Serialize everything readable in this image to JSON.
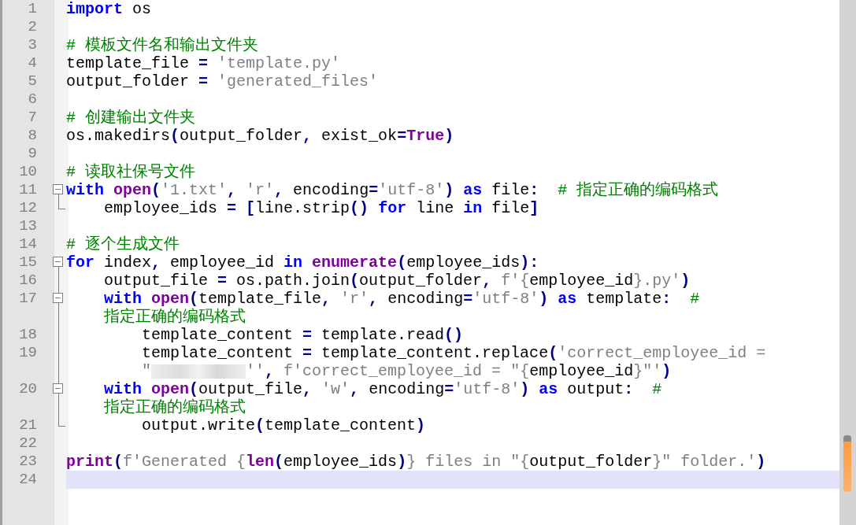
{
  "editor": {
    "lines": [
      {
        "number": "1",
        "current": false,
        "kind": "plain",
        "rows": [
          {
            "tokens": [
              {
                "kind": "keyword",
                "text": "import"
              },
              {
                "kind": "text",
                "text": " os"
              }
            ]
          }
        ]
      },
      {
        "number": "2",
        "current": false,
        "kind": "plain"
      },
      {
        "number": "3",
        "current": false,
        "kind": "plain",
        "rows": [
          {
            "tokens": [
              {
                "kind": "comment",
                "text": "# 模板文件名和输出文件夹"
              }
            ]
          }
        ]
      },
      {
        "number": "4",
        "current": false,
        "kind": "plain",
        "rows": [
          {
            "tokens": [
              {
                "kind": "text",
                "text": "template_file "
              },
              {
                "kind": "operator",
                "text": "="
              },
              {
                "kind": "string",
                "text": " 'template.py'"
              }
            ]
          }
        ]
      },
      {
        "number": "5",
        "current": false,
        "kind": "plain",
        "rows": [
          {
            "tokens": [
              {
                "kind": "text",
                "text": "output_folder "
              },
              {
                "kind": "operator",
                "text": "="
              },
              {
                "kind": "string",
                "text": " 'generated_files'"
              }
            ]
          }
        ]
      },
      {
        "number": "6",
        "current": false,
        "kind": "plain"
      },
      {
        "number": "7",
        "current": false,
        "kind": "plain",
        "rows": [
          {
            "tokens": [
              {
                "kind": "comment",
                "text": "# 创建输出文件夹"
              }
            ]
          }
        ]
      },
      {
        "number": "8",
        "current": false,
        "kind": "plain",
        "rows": [
          {
            "tokens": [
              {
                "kind": "text",
                "text": "os.makedirs"
              },
              {
                "kind": "operator",
                "text": "("
              },
              {
                "kind": "text",
                "text": "output_folder"
              },
              {
                "kind": "operator",
                "text": ","
              },
              {
                "kind": "text",
                "text": " exist_ok"
              },
              {
                "kind": "operator",
                "text": "="
              },
              {
                "kind": "builtin",
                "text": "True"
              },
              {
                "kind": "operator",
                "text": ")"
              }
            ]
          }
        ]
      },
      {
        "number": "9",
        "current": false,
        "kind": "plain"
      },
      {
        "number": "10",
        "current": false,
        "kind": "plain",
        "rows": [
          {
            "tokens": [
              {
                "kind": "comment",
                "text": "# 读取社保号文件"
              }
            ]
          }
        ]
      },
      {
        "number": "11",
        "current": false,
        "kind": "opener",
        "rows": [
          {
            "tokens": [
              {
                "kind": "keyword",
                "text": "with"
              },
              {
                "kind": "builtin",
                "text": " open"
              },
              {
                "kind": "operator",
                "text": "("
              },
              {
                "kind": "string",
                "text": "'1.txt'"
              },
              {
                "kind": "operator",
                "text": ","
              },
              {
                "kind": "string",
                "text": " 'r'"
              },
              {
                "kind": "operator",
                "text": ","
              },
              {
                "kind": "text",
                "text": " encoding"
              },
              {
                "kind": "operator",
                "text": "="
              },
              {
                "kind": "string",
                "text": "'utf-8'"
              },
              {
                "kind": "operator",
                "text": ")"
              },
              {
                "kind": "keyword",
                "text": " as"
              },
              {
                "kind": "text",
                "text": " file"
              },
              {
                "kind": "operator",
                "text": ":"
              },
              {
                "kind": "comment",
                "text": "  # 指定正确的编码格式"
              }
            ]
          }
        ]
      },
      {
        "number": "12",
        "current": false,
        "kind": "closer",
        "rows": [
          {
            "tokens": [
              {
                "kind": "text",
                "text": "    employee_ids "
              },
              {
                "kind": "operator",
                "text": "="
              },
              {
                "kind": "operator",
                "text": " ["
              },
              {
                "kind": "text",
                "text": "line.strip"
              },
              {
                "kind": "operator",
                "text": "()"
              },
              {
                "kind": "keyword",
                "text": " for"
              },
              {
                "kind": "text",
                "text": " line "
              },
              {
                "kind": "keyword",
                "text": "in"
              },
              {
                "kind": "text",
                "text": " file"
              },
              {
                "kind": "operator",
                "text": "]"
              }
            ]
          }
        ]
      },
      {
        "number": "13",
        "current": false,
        "kind": "plain"
      },
      {
        "number": "14",
        "current": false,
        "kind": "plain",
        "rows": [
          {
            "tokens": [
              {
                "kind": "comment",
                "text": "# 逐个生成文件"
              }
            ]
          }
        ]
      },
      {
        "number": "15",
        "current": false,
        "kind": "opener",
        "rows": [
          {
            "tokens": [
              {
                "kind": "keyword",
                "text": "for"
              },
              {
                "kind": "text",
                "text": " index"
              },
              {
                "kind": "operator",
                "text": ","
              },
              {
                "kind": "text",
                "text": " employee_id "
              },
              {
                "kind": "keyword",
                "text": "in"
              },
              {
                "kind": "builtin",
                "text": " enumerate"
              },
              {
                "kind": "operator",
                "text": "("
              },
              {
                "kind": "text",
                "text": "employee_ids"
              },
              {
                "kind": "operator",
                "text": "):"
              }
            ]
          }
        ]
      },
      {
        "number": "16",
        "current": false,
        "kind": "inner",
        "rows": [
          {
            "tokens": [
              {
                "kind": "text",
                "text": "    output_file "
              },
              {
                "kind": "operator",
                "text": "="
              },
              {
                "kind": "text",
                "text": " os.path.join"
              },
              {
                "kind": "operator",
                "text": "("
              },
              {
                "kind": "text",
                "text": "output_folder"
              },
              {
                "kind": "operator",
                "text": ","
              },
              {
                "kind": "string",
                "text": " f'{"
              },
              {
                "kind": "text",
                "text": "employee_id"
              },
              {
                "kind": "string",
                "text": "}.py'"
              },
              {
                "kind": "operator",
                "text": ")"
              }
            ]
          }
        ]
      },
      {
        "number": "17",
        "current": false,
        "kind": "opener",
        "rows": [
          {
            "tokens": [
              {
                "kind": "keyword",
                "text": "    with"
              },
              {
                "kind": "builtin",
                "text": " open"
              },
              {
                "kind": "operator",
                "text": "("
              },
              {
                "kind": "text",
                "text": "template_file"
              },
              {
                "kind": "operator",
                "text": ","
              },
              {
                "kind": "string",
                "text": " 'r'"
              },
              {
                "kind": "operator",
                "text": ","
              },
              {
                "kind": "text",
                "text": " encoding"
              },
              {
                "kind": "operator",
                "text": "="
              },
              {
                "kind": "string",
                "text": "'utf-8'"
              },
              {
                "kind": "operator",
                "text": ")"
              },
              {
                "kind": "keyword",
                "text": " as"
              },
              {
                "kind": "text",
                "text": " template"
              },
              {
                "kind": "operator",
                "text": ":"
              },
              {
                "kind": "comment",
                "text": "  #"
              }
            ]
          },
          {
            "tokens": [
              {
                "kind": "comment",
                "text": "指定正确的编码格式"
              }
            ]
          }
        ]
      },
      {
        "number": "18",
        "current": false,
        "kind": "inner",
        "rows": [
          {
            "tokens": [
              {
                "kind": "text",
                "text": "        template_content "
              },
              {
                "kind": "operator",
                "text": "="
              },
              {
                "kind": "text",
                "text": " template.read"
              },
              {
                "kind": "operator",
                "text": "()"
              }
            ]
          }
        ]
      },
      {
        "number": "19",
        "current": false,
        "kind": "inner",
        "rows": [
          {
            "tokens": [
              {
                "kind": "text",
                "text": "        template_content "
              },
              {
                "kind": "operator",
                "text": "="
              },
              {
                "kind": "text",
                "text": " template_content.replace"
              },
              {
                "kind": "operator",
                "text": "("
              },
              {
                "kind": "string",
                "text": "'correct_employee_id ="
              }
            ]
          },
          {
            "tokens": [
              {
                "kind": "string",
                "text": "\""
              },
              {
                "kind": "redacted"
              },
              {
                "kind": "string",
                "text": "''"
              },
              {
                "kind": "operator",
                "text": ","
              },
              {
                "kind": "string",
                "text": " f'correct_employee_id = \"{"
              },
              {
                "kind": "text",
                "text": "employee_id"
              },
              {
                "kind": "string",
                "text": "}\"'"
              },
              {
                "kind": "operator",
                "text": ")"
              }
            ]
          }
        ]
      },
      {
        "number": "20",
        "current": false,
        "kind": "opener",
        "rows": [
          {
            "tokens": [
              {
                "kind": "keyword",
                "text": "    with"
              },
              {
                "kind": "builtin",
                "text": " open"
              },
              {
                "kind": "operator",
                "text": "("
              },
              {
                "kind": "text",
                "text": "output_file"
              },
              {
                "kind": "operator",
                "text": ","
              },
              {
                "kind": "string",
                "text": " 'w'"
              },
              {
                "kind": "operator",
                "text": ","
              },
              {
                "kind": "text",
                "text": " encoding"
              },
              {
                "kind": "operator",
                "text": "="
              },
              {
                "kind": "string",
                "text": "'utf-8'"
              },
              {
                "kind": "operator",
                "text": ")"
              },
              {
                "kind": "keyword",
                "text": " as"
              },
              {
                "kind": "text",
                "text": " output"
              },
              {
                "kind": "operator",
                "text": ":"
              },
              {
                "kind": "comment",
                "text": "  #"
              }
            ]
          },
          {
            "tokens": [
              {
                "kind": "comment",
                "text": "指定正确的编码格式"
              }
            ]
          }
        ]
      },
      {
        "number": "21",
        "current": false,
        "kind": "closer",
        "rows": [
          {
            "tokens": [
              {
                "kind": "text",
                "text": "        output.write"
              },
              {
                "kind": "operator",
                "text": "("
              },
              {
                "kind": "text",
                "text": "template_content"
              },
              {
                "kind": "operator",
                "text": ")"
              }
            ]
          }
        ]
      },
      {
        "number": "22",
        "current": false,
        "kind": "plain"
      },
      {
        "number": "23",
        "current": false,
        "kind": "plain",
        "rows": [
          {
            "tokens": [
              {
                "kind": "builtin",
                "text": "print"
              },
              {
                "kind": "operator",
                "text": "("
              },
              {
                "kind": "string",
                "text": "f'Generated {"
              },
              {
                "kind": "builtin",
                "text": "len"
              },
              {
                "kind": "operator",
                "text": "("
              },
              {
                "kind": "text",
                "text": "employee_ids"
              },
              {
                "kind": "operator",
                "text": ")"
              },
              {
                "kind": "string",
                "text": "} files in \"{"
              },
              {
                "kind": "text",
                "text": "output_folder"
              },
              {
                "kind": "string",
                "text": "}\" folder.'"
              },
              {
                "kind": "operator",
                "text": ")"
              }
            ]
          }
        ]
      },
      {
        "number": "24",
        "current": true,
        "kind": "plain"
      }
    ]
  }
}
